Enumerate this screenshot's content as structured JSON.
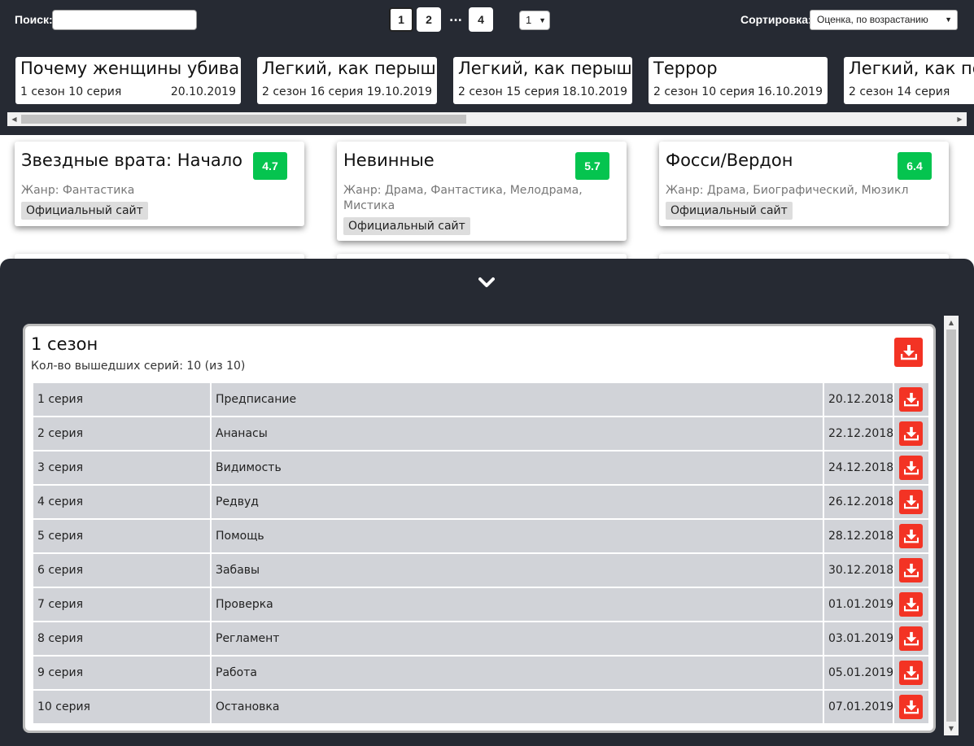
{
  "colors": {
    "dark_bg": "#262a33",
    "rating_green": "#05c44f",
    "download_red": "#f33324",
    "row_bg": "#d1d3d8"
  },
  "header": {
    "search_label": "Поиск:",
    "search_value": "",
    "pages": [
      "1",
      "2",
      "4"
    ],
    "current_page": "1",
    "ellipsis": "...",
    "per_page": "1",
    "sort_label": "Сортировка:",
    "sort_value": "Оценка, по возрастанию"
  },
  "recent": [
    {
      "title": "Почему женщины убивают",
      "episode": "1 сезон 10 серия",
      "date": "20.10.2019"
    },
    {
      "title": "Легкий, как перышко",
      "episode": "2 сезон 16 серия",
      "date": "19.10.2019"
    },
    {
      "title": "Легкий, как перышко",
      "episode": "2 сезон 15 серия",
      "date": "18.10.2019"
    },
    {
      "title": "Террор",
      "episode": "2 сезон 10 серия",
      "date": "16.10.2019"
    },
    {
      "title": "Легкий, как перышко",
      "episode": "2 сезон 14 серия",
      "date": ""
    }
  ],
  "shows": [
    {
      "title": "Звездные врата: Начало",
      "rating": "4.7",
      "genre": "Жанр: Фантастика",
      "site": "Официальный сайт"
    },
    {
      "title": "Невинные",
      "rating": "5.7",
      "genre_line1": "Жанр: Драма, Фантастика, Мелодрама,",
      "genre_line2": "Мистика",
      "site": "Официальный сайт"
    },
    {
      "title": "Фосси/Вердон",
      "rating": "6.4",
      "genre": "Жанр: Драма, Биографический, Мюзикл",
      "site": "Официальный сайт"
    }
  ],
  "season": {
    "title": "1 сезон",
    "subtitle": "Кол-во вышедших серий: 10 (из 10)",
    "episodes": [
      {
        "number": "1 серия",
        "name": "Предписание",
        "date": "20.12.2018"
      },
      {
        "number": "2 серия",
        "name": "Ананасы",
        "date": "22.12.2018"
      },
      {
        "number": "3 серия",
        "name": "Видимость",
        "date": "24.12.2018"
      },
      {
        "number": "4 серия",
        "name": "Редвуд",
        "date": "26.12.2018"
      },
      {
        "number": "5 серия",
        "name": "Помощь",
        "date": "28.12.2018"
      },
      {
        "number": "6 серия",
        "name": "Забавы",
        "date": "30.12.2018"
      },
      {
        "number": "7 серия",
        "name": "Проверка",
        "date": "01.01.2019"
      },
      {
        "number": "8 серия",
        "name": "Регламент",
        "date": "03.01.2019"
      },
      {
        "number": "9 серия",
        "name": "Работа",
        "date": "05.01.2019"
      },
      {
        "number": "10 серия",
        "name": "Остановка",
        "date": "07.01.2019"
      }
    ]
  },
  "icons": {
    "collapse": "chevron-down-icon",
    "download": "download-icon",
    "scroll_left": "arrow-left-icon",
    "scroll_right": "arrow-right-icon",
    "scroll_up": "arrow-up-icon",
    "scroll_down": "arrow-down-icon"
  }
}
